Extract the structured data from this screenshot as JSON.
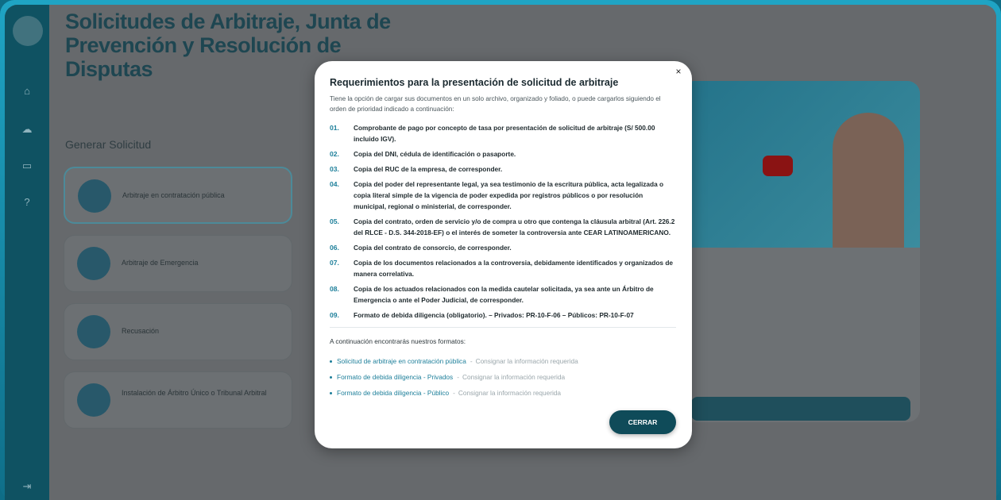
{
  "background": {
    "page_title": "Solicitudes de Arbitraje, Junta de Prevención y Resolución de Disputas",
    "section_title": "Generar Solicitud",
    "cards": [
      {
        "label": "Arbitraje en contratación pública"
      },
      {
        "label": "Arbitraje de Emergencia"
      },
      {
        "label": "Recusación"
      },
      {
        "label": "Instalación de Árbitro Único o Tribunal Arbitral"
      }
    ]
  },
  "modal": {
    "title": "Requerimientos para la presentación de solicitud de arbitraje",
    "subtitle": "Tiene la opción de cargar sus documentos en un solo archivo, organizado y foliado, o puede cargarlos siguiendo el orden de prioridad indicado a continuación:",
    "requirements": [
      {
        "num": "01.",
        "text": "Comprobante de pago por concepto de tasa por presentación de solicitud de arbitraje (S/ 500.00 incluido IGV)."
      },
      {
        "num": "02.",
        "text": "Copia del DNI, cédula de identificación o pasaporte."
      },
      {
        "num": "03.",
        "text": "Copia del RUC de la empresa, de corresponder."
      },
      {
        "num": "04.",
        "text": "Copia del poder del representante legal, ya sea testimonio de la escritura pública, acta legalizada o copia literal simple de la vigencia de poder expedida por registros públicos o por resolución municipal, regional o ministerial, de corresponder."
      },
      {
        "num": "05.",
        "text": "Copia del contrato, orden de servicio y/o de compra u otro que contenga la cláusula arbitral (Art. 226.2 del RLCE - D.S. 344-2018-EF) o el interés de someter la controversia ante CEAR LATINOAMERICANO."
      },
      {
        "num": "06.",
        "text": "Copia del contrato de consorcio, de corresponder."
      },
      {
        "num": "07.",
        "text": "Copia de los documentos relacionados a la controversia, debidamente identificados y organizados de manera correlativa."
      },
      {
        "num": "08.",
        "text": "Copia de los actuados relacionados con la medida cautelar solicitada, ya sea ante un Árbitro de Emergencia o ante el Poder Judicial, de corresponder."
      },
      {
        "num": "09.",
        "text": "Formato de debida diligencia (obligatorio). – Privados: PR-10-F-06 – Públicos: PR-10-F-07"
      }
    ],
    "formats_intro": "A continuación encontrarás nuestros formatos:",
    "formats": [
      {
        "link": "Solicitud de arbitraje en contratación pública",
        "sep": "-",
        "note": "Consignar la información requerida"
      },
      {
        "link": "Formato de debida diligencia - Privados",
        "sep": "-",
        "note": "Consignar la información requerida"
      },
      {
        "link": "Formato de debida diligencia - Público",
        "sep": "-",
        "note": "Consignar la información requerida"
      }
    ],
    "close_button": "CERRAR",
    "close_icon": "×"
  }
}
